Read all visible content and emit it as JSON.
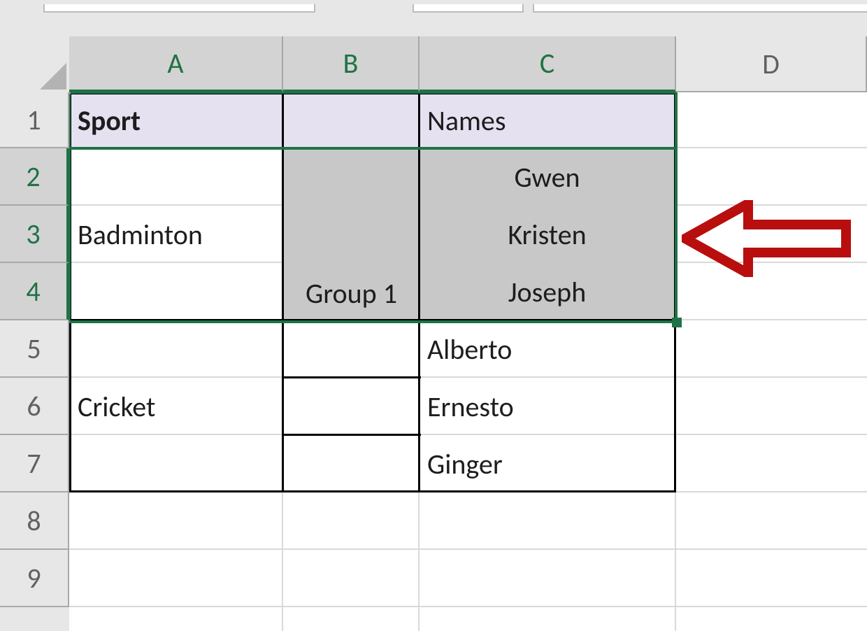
{
  "columns": {
    "A": "A",
    "B": "B",
    "C": "C",
    "D": "D"
  },
  "rows": {
    "1": "1",
    "2": "2",
    "3": "3",
    "4": "4",
    "5": "5",
    "6": "6",
    "7": "7",
    "8": "8",
    "9": "9"
  },
  "cells": {
    "A1": "Sport",
    "C1": "Names",
    "A2_4": "Badminton",
    "B4": "Group 1",
    "C2": "Gwen",
    "C3": "Kristen",
    "C4": "Joseph",
    "A5_7": "Cricket",
    "C5": "Alberto",
    "C6": "Ernesto",
    "C7": "Ginger"
  },
  "selection": {
    "range": "A2:C4",
    "active_cell": "A2"
  },
  "colors": {
    "header_fill": "#e6e1f1",
    "selection_border": "#1f7246",
    "selection_fill": "#c8c8c8",
    "arrow": "#b90e0e"
  }
}
